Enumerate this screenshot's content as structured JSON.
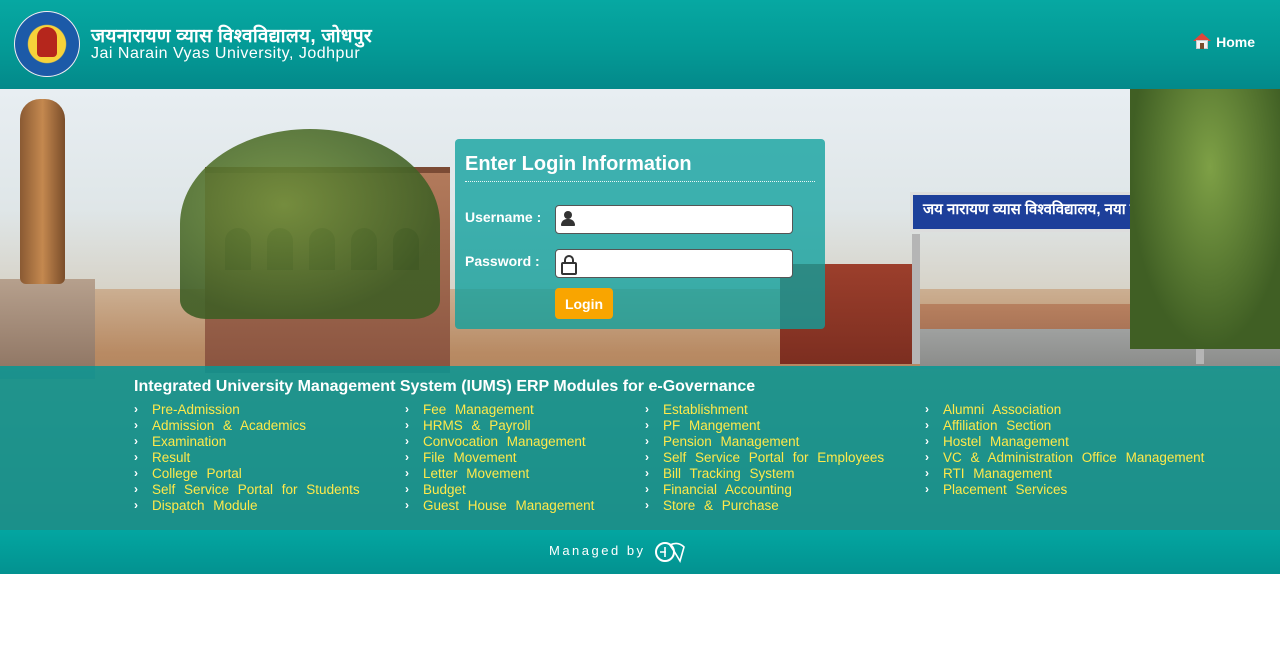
{
  "header": {
    "title_hindi": "जयनारायण व्यास विश्वविद्यालय, जोधपुर",
    "title_english": "Jai Narain Vyas University, Jodhpur",
    "home_label": "Home"
  },
  "banner": {
    "gate_text": "जय नारायण व्यास विश्वविद्यालय, नया परिसर"
  },
  "login": {
    "title": "Enter Login Information",
    "username_label": "Username :",
    "password_label": "Password :",
    "username_value": "",
    "password_value": "",
    "button_label": "Login"
  },
  "modules": {
    "title": "Integrated University Management System (IUMS) ERP Modules for  e-Governance",
    "columns": [
      [
        "Pre-Admission",
        "Admission & Academics",
        "Examination",
        "Result",
        "College Portal",
        "Self Service Portal for Students",
        "Dispatch Module"
      ],
      [
        "Fee Management",
        "HRMS & Payroll",
        "Convocation Management",
        "File Movement",
        "Letter Movement",
        "Budget",
        "Guest House Management"
      ],
      [
        "Establishment",
        "PF Mangement",
        "Pension Management",
        "Self Service Portal for Employees",
        "Bill Tracking System",
        "Financial Accounting",
        "Store & Purchase"
      ],
      [
        "Alumni Association",
        "Affiliation Section",
        "Hostel Management",
        "VC & Administration Office Management",
        "RTI Management",
        "Placement Services"
      ]
    ]
  },
  "footer": {
    "managed_by": "Managed by"
  },
  "colors": {
    "header_teal": "#049a96",
    "module_text": "#ffe94a",
    "login_button": "#f9a500"
  }
}
